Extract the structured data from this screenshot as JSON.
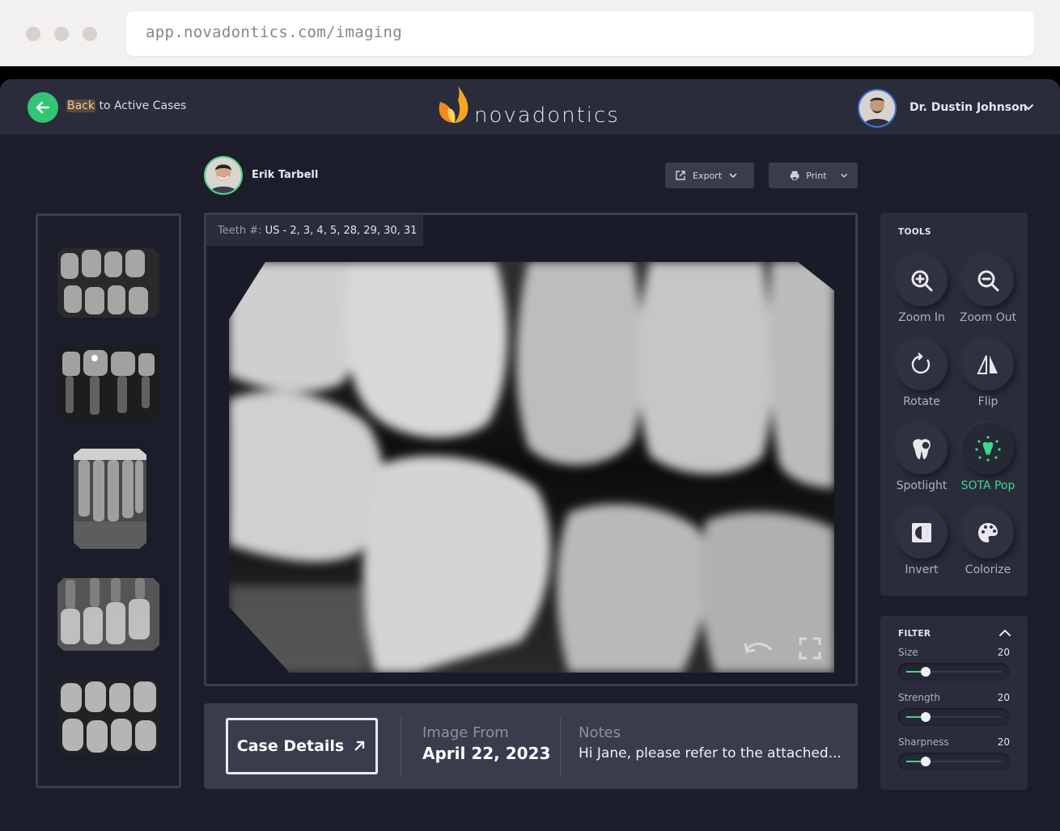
{
  "browser": {
    "url": "app.novadontics.com/imaging"
  },
  "header": {
    "back_prefix": "Back",
    "back_suffix": " to Active Cases",
    "logo_text": "novadontics",
    "user_name": "Dr. Dustin Johnson"
  },
  "patient": {
    "name": "Erik Tarbell"
  },
  "actions": {
    "export_label": "Export",
    "print_label": "Print"
  },
  "viewer": {
    "teeth_label": "Teeth #:",
    "teeth_value": "US - 2, 3, 4, 5, 28, 29, 30, 31"
  },
  "tools": {
    "title": "TOOLS",
    "items": [
      {
        "label": "Zoom In",
        "icon": "zoom-in-icon"
      },
      {
        "label": "Zoom Out",
        "icon": "zoom-out-icon"
      },
      {
        "label": "Rotate",
        "icon": "rotate-icon"
      },
      {
        "label": "Flip",
        "icon": "flip-icon"
      },
      {
        "label": "Spotlight",
        "icon": "spotlight-icon"
      },
      {
        "label": "SOTA Pop",
        "icon": "sota-pop-icon",
        "active": true
      },
      {
        "label": "Invert",
        "icon": "invert-icon"
      },
      {
        "label": "Colorize",
        "icon": "palette-icon"
      }
    ]
  },
  "filter": {
    "title": "FILTER",
    "items": [
      {
        "label": "Size",
        "value": "20",
        "fraction": 0.2
      },
      {
        "label": "Strength",
        "value": "20",
        "fraction": 0.2
      },
      {
        "label": "Sharpness",
        "value": "20",
        "fraction": 0.2
      }
    ]
  },
  "footer": {
    "case_details_label": "Case Details",
    "image_from_label": "Image From",
    "image_from_value": "April 22, 2023",
    "notes_label": "Notes",
    "notes_value": "Hi Jane, please refer to the attached..."
  },
  "colors": {
    "accent": "#3fd888",
    "back_button": "#32c574",
    "panel": "#2b2c3b",
    "background": "#1c1d2b"
  }
}
